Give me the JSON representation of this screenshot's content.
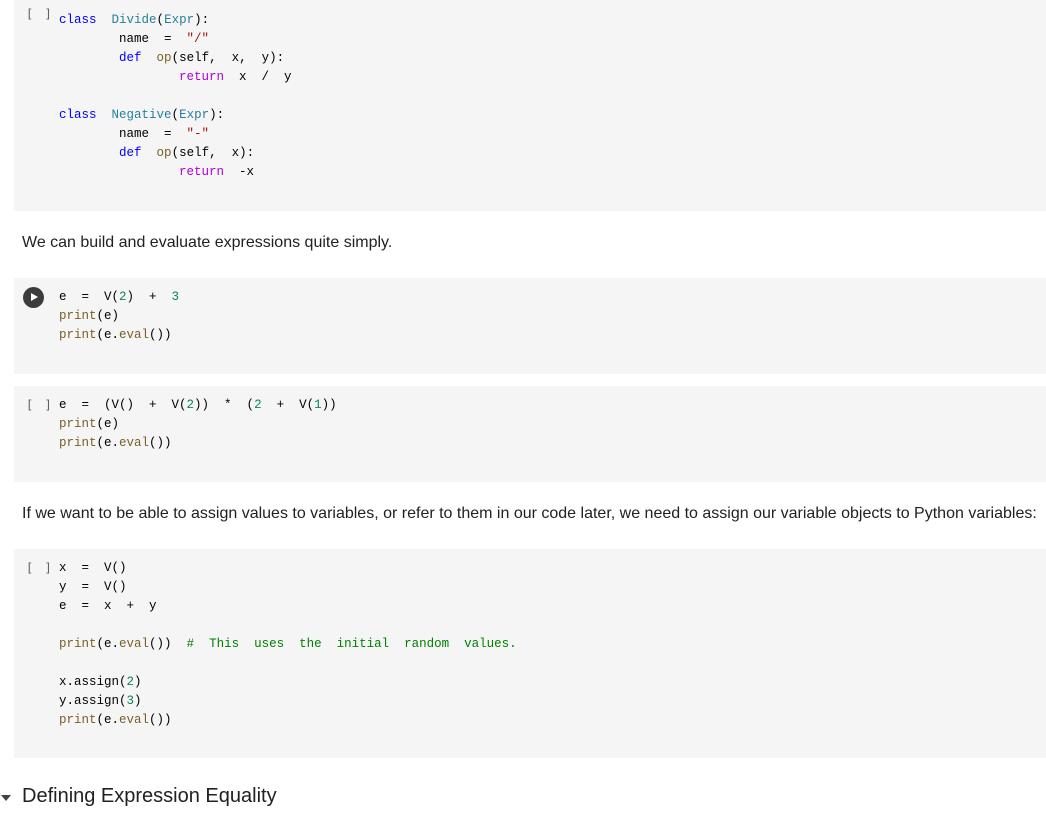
{
  "cells": [
    {
      "type": "code",
      "state": "[ ]",
      "lines": [
        [
          {
            "t": "class",
            "c": "kw"
          },
          {
            "t": "  "
          },
          {
            "t": "Divide",
            "c": "cls"
          },
          {
            "t": "("
          },
          {
            "t": "Expr",
            "c": "cls"
          },
          {
            "t": "):"
          }
        ],
        [
          {
            "t": "        name  =  "
          },
          {
            "t": "\"/\"",
            "c": "str"
          }
        ],
        [
          {
            "t": "        "
          },
          {
            "t": "def",
            "c": "kw"
          },
          {
            "t": "  "
          },
          {
            "t": "op",
            "c": "fn"
          },
          {
            "t": "(self,  x,  y):"
          }
        ],
        [
          {
            "t": "                "
          },
          {
            "t": "return",
            "c": "ret"
          },
          {
            "t": "  x  /  y"
          }
        ],
        [
          {
            "t": ""
          }
        ],
        [
          {
            "t": "class",
            "c": "kw"
          },
          {
            "t": "  "
          },
          {
            "t": "Negative",
            "c": "cls"
          },
          {
            "t": "("
          },
          {
            "t": "Expr",
            "c": "cls"
          },
          {
            "t": "):"
          }
        ],
        [
          {
            "t": "        name  =  "
          },
          {
            "t": "\"-\"",
            "c": "str"
          }
        ],
        [
          {
            "t": "        "
          },
          {
            "t": "def",
            "c": "kw"
          },
          {
            "t": "  "
          },
          {
            "t": "op",
            "c": "fn"
          },
          {
            "t": "(self,  x):"
          }
        ],
        [
          {
            "t": "                "
          },
          {
            "t": "return",
            "c": "ret"
          },
          {
            "t": "  -x"
          }
        ]
      ]
    },
    {
      "type": "text",
      "text": "We can build and evaluate expressions quite simply."
    },
    {
      "type": "code",
      "state": "run",
      "lines": [
        [
          {
            "t": "e  =  V("
          },
          {
            "t": "2",
            "c": "num"
          },
          {
            "t": ")  +  "
          },
          {
            "t": "3",
            "c": "num"
          }
        ],
        [
          {
            "t": "print",
            "c": "fn"
          },
          {
            "t": "(e)"
          }
        ],
        [
          {
            "t": "print",
            "c": "fn"
          },
          {
            "t": "(e."
          },
          {
            "t": "eval",
            "c": "fn"
          },
          {
            "t": "())"
          }
        ]
      ]
    },
    {
      "type": "code",
      "state": "[ ]",
      "lines": [
        [
          {
            "t": "e  =  (V()  +  V("
          },
          {
            "t": "2",
            "c": "num"
          },
          {
            "t": "))  *  ("
          },
          {
            "t": "2",
            "c": "num"
          },
          {
            "t": "  +  V("
          },
          {
            "t": "1",
            "c": "num"
          },
          {
            "t": "))"
          }
        ],
        [
          {
            "t": "print",
            "c": "fn"
          },
          {
            "t": "(e)"
          }
        ],
        [
          {
            "t": "print",
            "c": "fn"
          },
          {
            "t": "(e."
          },
          {
            "t": "eval",
            "c": "fn"
          },
          {
            "t": "())"
          }
        ]
      ]
    },
    {
      "type": "text",
      "text": "If we want to be able to assign values to variables, or refer to them in our code later, we need to assign our variable objects to Python variables:"
    },
    {
      "type": "code",
      "state": "[ ]",
      "lines": [
        [
          {
            "t": "x  =  V()"
          }
        ],
        [
          {
            "t": "y  =  V()"
          }
        ],
        [
          {
            "t": "e  =  x  +  y"
          }
        ],
        [
          {
            "t": ""
          }
        ],
        [
          {
            "t": "print",
            "c": "fn"
          },
          {
            "t": "(e."
          },
          {
            "t": "eval",
            "c": "fn"
          },
          {
            "t": "())  "
          },
          {
            "t": "#  This  uses  the  initial  random  values.",
            "c": "cmt"
          }
        ],
        [
          {
            "t": ""
          }
        ],
        [
          {
            "t": "x.assign("
          },
          {
            "t": "2",
            "c": "num"
          },
          {
            "t": ")"
          }
        ],
        [
          {
            "t": "y.assign("
          },
          {
            "t": "3",
            "c": "num"
          },
          {
            "t": ")"
          }
        ],
        [
          {
            "t": "print",
            "c": "fn"
          },
          {
            "t": "(e."
          },
          {
            "t": "eval",
            "c": "fn"
          },
          {
            "t": "())"
          }
        ]
      ]
    }
  ],
  "section_heading": {
    "title": "Defining Expression Equality",
    "icon": "caret-down-icon"
  },
  "colors": {
    "cell_background": "#f5f5f5",
    "keyword": "#0000ff",
    "class_name": "#267f99",
    "function": "#795e26",
    "string": "#a31515",
    "number": "#098658",
    "return": "#af00db",
    "comment": "#008000"
  }
}
